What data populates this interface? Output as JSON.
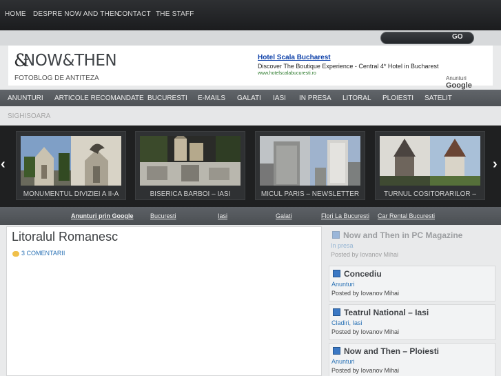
{
  "topnav": {
    "items": [
      "HOME",
      "DESPRE NOW AND THEN",
      "CONTACT",
      "THE STAFF"
    ]
  },
  "search": {
    "button": "GO"
  },
  "header": {
    "logo_amp": "&",
    "logo_text": "NOW&THEN",
    "tagline": "FOTOBLOG DE ANTITEZA",
    "ad": {
      "title": "Hotel Scala Bucharest",
      "text": "Discover The Boutique Experience - Central 4* Hotel in Bucharest",
      "url": "www.hotelscalabucuresti.ro",
      "label": "Anunturi",
      "brand": "Google"
    }
  },
  "categories": [
    "ANUNTURI",
    "ARTICOLE RECOMANDATE",
    "BUCURESTI",
    "E-MAILS",
    "GALATI",
    "IASI",
    "IN PRESA",
    "LITORAL",
    "PLOIESTI",
    "SATELIT"
  ],
  "categories_row2": [
    "SIGHISOARA"
  ],
  "gallery": {
    "prev": "‹",
    "next": "›",
    "slides": [
      "MONUMENTUL DIVIZIEI A II-A",
      "BISERICA BARBOI – IASI",
      "MICUL PARIS – NEWSLETTER",
      "TURNUL COSITORARILOR –"
    ]
  },
  "google_bar": [
    "Anunturi prin Google",
    "Bucuresti",
    "Iasi",
    "Galati",
    "Flori La Bucuresti",
    "Car Rental Bucuresti"
  ],
  "post": {
    "title": "Litoralul Romanesc",
    "comments": "3 COMENTARII"
  },
  "sidebar": [
    {
      "title": "Now and Then in PC Magazine",
      "category": "In presa",
      "byline": "Posted by Iovanov Mihai"
    },
    {
      "title": "Concediu",
      "category": "Anunturi",
      "byline": "Posted by Iovanov Mihai"
    },
    {
      "title": "Teatrul National – Iasi",
      "category": "Cladiri, Iasi",
      "byline": "Posted by Iovanov Mihai"
    },
    {
      "title": "Now and Then – Ploiesti",
      "category": "Anunturi",
      "byline": "Posted by Iovanov Mihai"
    }
  ]
}
